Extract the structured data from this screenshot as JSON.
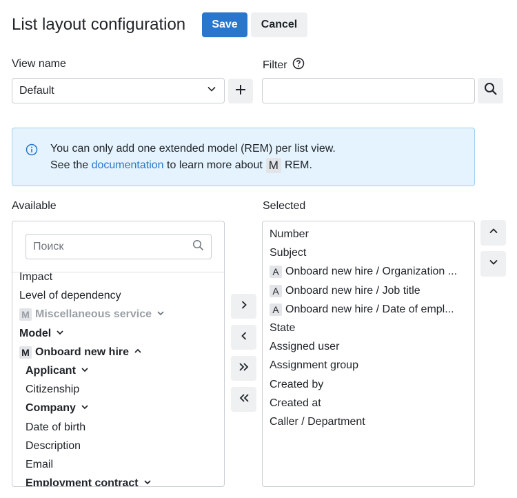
{
  "header": {
    "title": "List layout configuration",
    "save_label": "Save",
    "cancel_label": "Cancel"
  },
  "view_name": {
    "label": "View name",
    "value": "Default"
  },
  "filter": {
    "label": "Filter",
    "value": "",
    "placeholder": ""
  },
  "banner": {
    "line1": "You can only add one extended model (REM) per list view.",
    "line2_prefix": "See the",
    "link_text": "documentation",
    "line2_middle": "to learn more about",
    "badge": "M",
    "line2_suffix": "REM."
  },
  "available": {
    "label": "Available",
    "search_placeholder": "Поиск",
    "items": [
      {
        "text": "Impact",
        "style": "normal",
        "indent": 0
      },
      {
        "text": "Level of dependency",
        "style": "normal",
        "indent": 0
      },
      {
        "text": "Miscellaneous service",
        "style": "muted",
        "indent": 0,
        "badge": "M",
        "chevron": "down"
      },
      {
        "text": "Model",
        "style": "bold",
        "indent": 0,
        "chevron": "down"
      },
      {
        "text": "Onboard new hire",
        "style": "bold",
        "indent": 0,
        "badge": "M",
        "chevron": "up"
      },
      {
        "text": "Applicant",
        "style": "bold",
        "indent": 1,
        "chevron": "down"
      },
      {
        "text": "Citizenship",
        "style": "normal",
        "indent": 1
      },
      {
        "text": "Company",
        "style": "bold",
        "indent": 1,
        "chevron": "down"
      },
      {
        "text": "Date of birth",
        "style": "normal",
        "indent": 1
      },
      {
        "text": "Description",
        "style": "normal",
        "indent": 1
      },
      {
        "text": "Email",
        "style": "normal",
        "indent": 1
      },
      {
        "text": "Employment contract",
        "style": "bold",
        "indent": 1,
        "chevron": "down"
      }
    ]
  },
  "selected": {
    "label": "Selected",
    "items": [
      {
        "text": "Number"
      },
      {
        "text": "Subject"
      },
      {
        "text": "Onboard new hire / Organization ...",
        "badge": "A"
      },
      {
        "text": "Onboard new hire / Job title",
        "badge": "A"
      },
      {
        "text": "Onboard new hire / Date of empl...",
        "badge": "A"
      },
      {
        "text": "State"
      },
      {
        "text": "Assigned user"
      },
      {
        "text": "Assignment group"
      },
      {
        "text": "Created by"
      },
      {
        "text": "Created at"
      },
      {
        "text": "Caller / Department"
      }
    ]
  },
  "colors": {
    "primary": "#2a76cc",
    "banner_bg": "#e4f3fd",
    "banner_border": "#9fd1f0",
    "muted_text": "#9aa0a6"
  }
}
